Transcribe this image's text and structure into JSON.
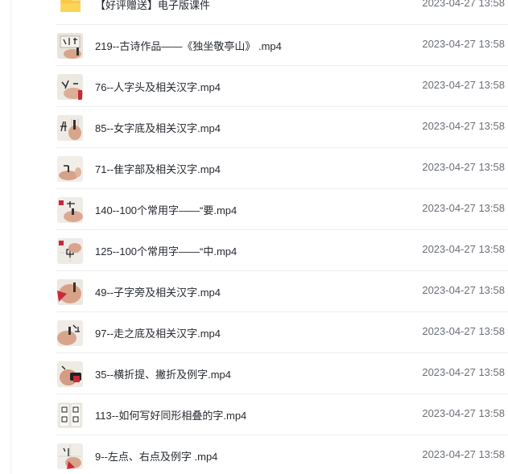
{
  "files": [
    {
      "name": "【好评赠送】电子版课件",
      "date": "2023-04-27 13:58",
      "icon": "folder-icon"
    },
    {
      "name": "219--古诗作品——《独坐敬亭山》 .mp4",
      "date": "2023-04-27 13:58",
      "icon": "video-thumbnail-icon"
    },
    {
      "name": "76--人字头及相关汉字.mp4",
      "date": "2023-04-27 13:58",
      "icon": "video-thumbnail-icon"
    },
    {
      "name": "85--女字底及相关汉字.mp4",
      "date": "2023-04-27 13:58",
      "icon": "video-thumbnail-icon"
    },
    {
      "name": "71--隹字部及相关汉字.mp4",
      "date": "2023-04-27 13:58",
      "icon": "video-thumbnail-icon"
    },
    {
      "name": "140--100个常用字——“要.mp4",
      "date": "2023-04-27 13:58",
      "icon": "video-thumbnail-icon"
    },
    {
      "name": "125--100个常用字——“中.mp4",
      "date": "2023-04-27 13:58",
      "icon": "video-thumbnail-icon"
    },
    {
      "name": "49--子字旁及相关汉字.mp4",
      "date": "2023-04-27 13:58",
      "icon": "video-thumbnail-icon"
    },
    {
      "name": "97--走之底及相关汉字.mp4",
      "date": "2023-04-27 13:58",
      "icon": "video-thumbnail-icon"
    },
    {
      "name": "35--横折提、撇折及例字.mp4",
      "date": "2023-04-27 13:58",
      "icon": "video-thumbnail-icon"
    },
    {
      "name": "113--如何写好同形相叠的字.mp4",
      "date": "2023-04-27 13:58",
      "icon": "video-thumbnail-icon"
    },
    {
      "name": "9--左点、右点及例字 .mp4",
      "date": "2023-04-27 13:58",
      "icon": "video-thumbnail-icon"
    }
  ],
  "colors": {
    "folder": "#f7c948",
    "text": "#262a30",
    "date": "#6b7078",
    "divider": "#eceef1"
  }
}
